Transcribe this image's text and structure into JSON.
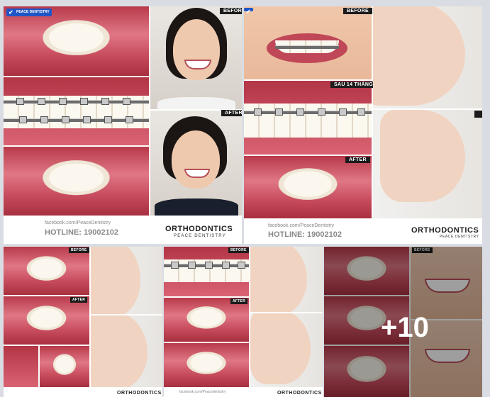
{
  "post": {
    "logo_text": "PEACE DENTISTRY",
    "tiles": [
      {
        "labels": {
          "before": "BEFORE",
          "after": "AFTER"
        },
        "footer": {
          "facebook": "facebook.com/PeaceDentistry",
          "hotline": "HOTLINE: 19002102",
          "brand": "ORTHODONTICS",
          "brand_sub": "PEACE DENTISTRY"
        }
      },
      {
        "labels": {
          "before": "BEFORE",
          "during": "SAU 14 THÁNG",
          "after": "AFTER"
        },
        "footer": {
          "facebook": "facebook.com/PeaceDentistry",
          "hotline": "HOTLINE: 19002102",
          "brand": "ORTHODONTICS",
          "brand_sub": "PEACE DENTISTRY"
        }
      },
      {
        "labels": {
          "before": "BEFORE",
          "after": "AFTER"
        },
        "footer": {
          "brand": "ORTHODONTICS"
        }
      },
      {
        "labels": {
          "before": "BEFORE",
          "after": "AFTER"
        },
        "footer": {
          "facebook": "facebook.com/Peacedentistry",
          "brand": "ORTHODONTICS"
        }
      },
      {
        "labels": {
          "before": "BEFORE"
        }
      }
    ],
    "more_count": "+10"
  }
}
